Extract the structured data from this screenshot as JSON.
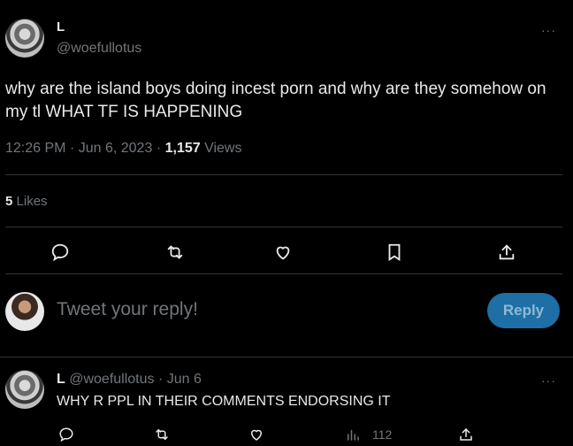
{
  "tweet": {
    "author_name": "L",
    "author_handle": "@woefullotus",
    "text": "why are the island boys doing incest porn and why are they somehow on my tl WHAT TF IS HAPPENING",
    "time": "12:26 PM",
    "date": "Jun 6, 2023",
    "views_count": "1,157",
    "views_label": "Views",
    "likes_count": "5",
    "likes_label": "Likes",
    "more_label": "···"
  },
  "actions": {
    "reply_icon": "comment-icon",
    "retweet_icon": "retweet-icon",
    "like_icon": "heart-icon",
    "bookmark_icon": "bookmark-icon",
    "share_icon": "share-icon"
  },
  "composer": {
    "placeholder": "Tweet your reply!",
    "button_label": "Reply",
    "button_color": "#1d6fa6"
  },
  "reply": {
    "author_name": "L",
    "author_handle": "@woefullotus",
    "date": "Jun 6",
    "text": "WHY R PPL IN THEIR COMMENTS ENDORSING IT",
    "views_count": "112",
    "more_label": "···"
  },
  "colors": {
    "background": "#000000",
    "text": "#e7e9ea",
    "muted": "#71767b",
    "divider": "#2f3336"
  }
}
